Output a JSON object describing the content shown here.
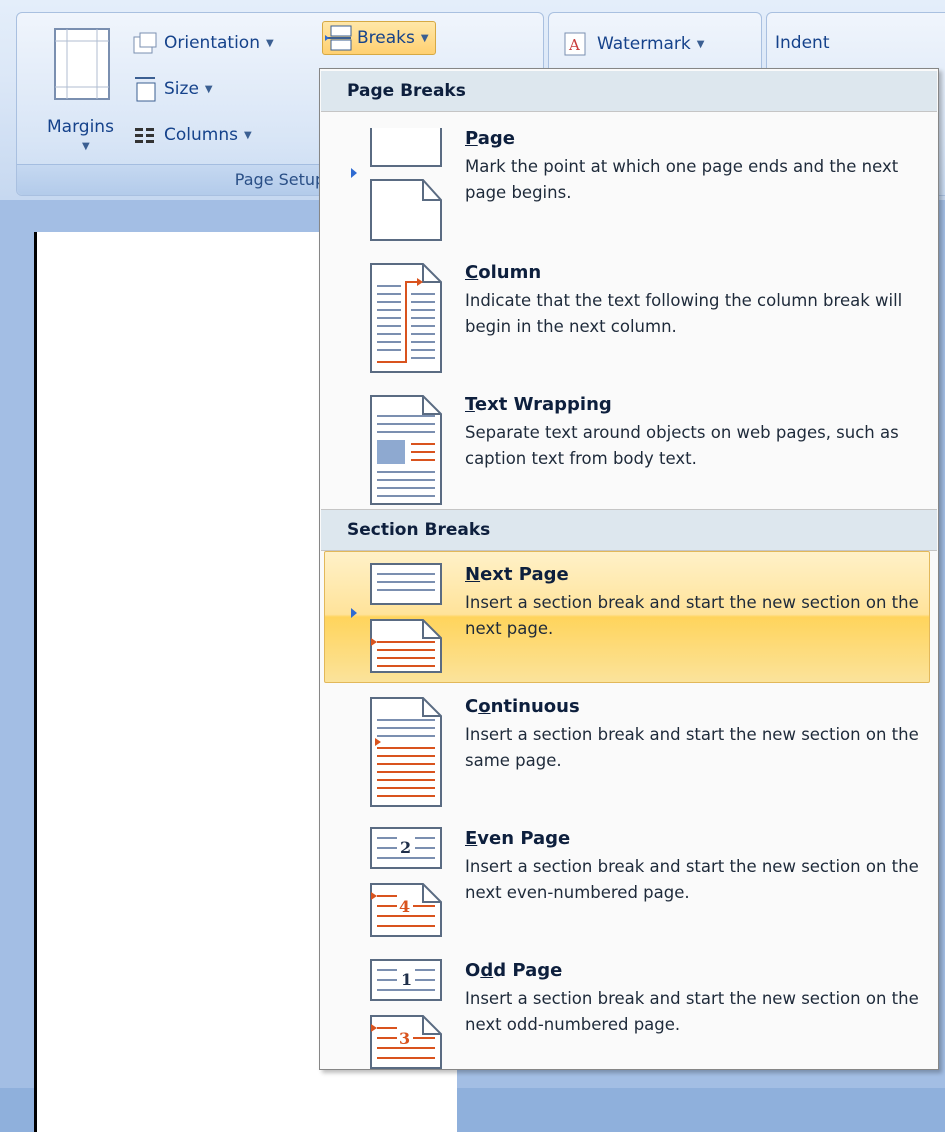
{
  "ribbon": {
    "margins_label": "Margins",
    "orientation_label": "Orientation",
    "size_label": "Size",
    "columns_label": "Columns",
    "breaks_label": "Breaks",
    "page_setup_label": "Page Setup",
    "watermark_label": "Watermark",
    "indent_label": "Indent"
  },
  "menu": {
    "page_breaks_header": "Page Breaks",
    "section_breaks_header": "Section Breaks",
    "items": [
      {
        "title_u": "P",
        "title_rest": "age",
        "desc": "Mark the point at which one page ends and the next page begins.",
        "icon": "page-break-icon"
      },
      {
        "title_u": "C",
        "title_rest": "olumn",
        "desc": "Indicate that the text following the column break will begin in the next column.",
        "icon": "column-break-icon"
      },
      {
        "title_u": "T",
        "title_rest": "ext Wrapping",
        "desc": "Separate text around objects on web pages, such as caption text from body text.",
        "icon": "text-wrapping-icon"
      },
      {
        "title_u": "N",
        "title_rest": "ext Page",
        "desc": "Insert a section break and start the new section on the next page.",
        "icon": "next-page-icon"
      },
      {
        "title_pre": "C",
        "title_u": "o",
        "title_rest": "ntinuous",
        "desc": "Insert a section break and start the new section on the same page.",
        "icon": "continuous-icon"
      },
      {
        "title_u": "E",
        "title_rest": "ven Page",
        "desc": "Insert a section break and start the new section on the next even-numbered page.",
        "icon": "even-page-icon"
      },
      {
        "title_pre": "O",
        "title_u": "d",
        "title_rest": "d Page",
        "desc": "Insert a section break and start the new section on the next odd-numbered page.",
        "icon": "odd-page-icon"
      }
    ],
    "even_num_top": "2",
    "even_num_bottom": "4",
    "odd_num_top": "1",
    "odd_num_bottom": "3"
  },
  "colors": {
    "highlight": "#ffd45c",
    "break_marker": "#d9531e",
    "ribbon_text": "#15428b"
  }
}
